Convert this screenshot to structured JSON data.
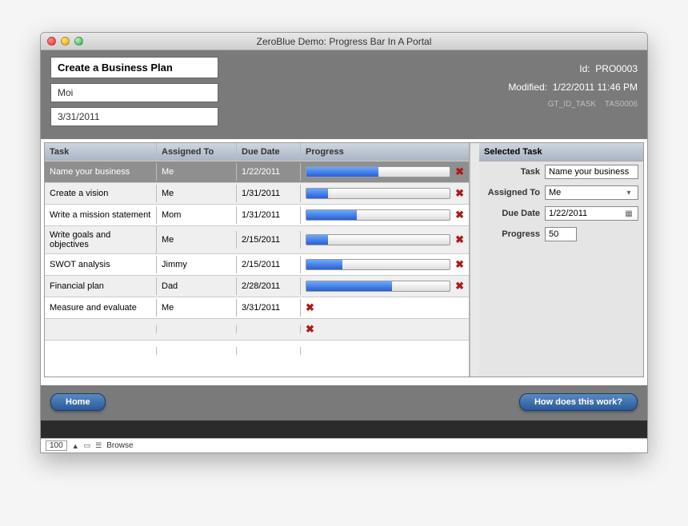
{
  "window": {
    "title": "ZeroBlue Demo:  Progress Bar In A Portal"
  },
  "header": {
    "plan_title": "Create a Business Plan",
    "owner": "Moi",
    "date": "3/31/2011",
    "id_label": "Id:",
    "id_value": "PRO0003",
    "modified_label": "Modified:",
    "modified_value": "1/22/2011 11:46 PM",
    "gt_label": "GT_ID_TASK",
    "gt_value": "TAS0006"
  },
  "columns": {
    "task": "Task",
    "assigned": "Assigned To",
    "due": "Due Date",
    "progress": "Progress"
  },
  "tasks": [
    {
      "name": "Name your business",
      "assigned": "Me",
      "due": "1/22/2011",
      "progress": 50,
      "selected": true
    },
    {
      "name": "Create a vision",
      "assigned": "Me",
      "due": "1/31/2011",
      "progress": 15
    },
    {
      "name": "Write a mission statement",
      "assigned": "Mom",
      "due": "1/31/2011",
      "progress": 35
    },
    {
      "name": "Write goals and objectives",
      "assigned": "Me",
      "due": "2/15/2011",
      "progress": 15
    },
    {
      "name": "SWOT analysis",
      "assigned": "Jimmy",
      "due": "2/15/2011",
      "progress": 25
    },
    {
      "name": "Financial plan",
      "assigned": "Dad",
      "due": "2/28/2011",
      "progress": 60
    },
    {
      "name": "Measure and evaluate",
      "assigned": "Me",
      "due": "3/31/2011",
      "progress": null
    },
    {
      "name": "",
      "assigned": "",
      "due": "",
      "progress": null
    },
    {
      "name": "",
      "assigned": "",
      "due": "",
      "progress": null,
      "no_delete": true
    }
  ],
  "selected_panel": {
    "title": "Selected Task",
    "labels": {
      "task": "Task",
      "assigned": "Assigned To",
      "due": "Due Date",
      "progress": "Progress"
    },
    "values": {
      "task": "Name your business",
      "assigned": "Me",
      "due": "1/22/2011",
      "progress": "50"
    }
  },
  "buttons": {
    "home": "Home",
    "help": "How does this work?"
  },
  "status": {
    "zoom": "100",
    "mode": "Browse"
  }
}
